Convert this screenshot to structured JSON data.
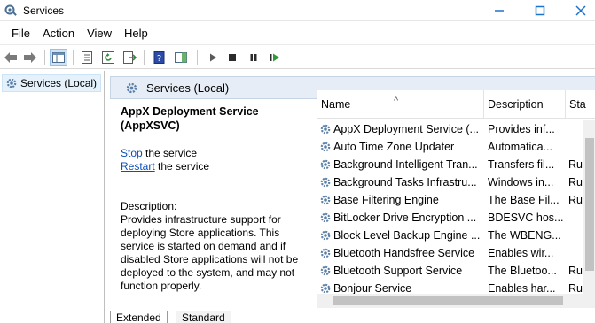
{
  "window": {
    "title": "Services"
  },
  "menu": {
    "items": [
      "File",
      "Action",
      "View",
      "Help"
    ]
  },
  "toolbar": {
    "icons": [
      "back-icon",
      "forward-icon",
      "console-tree-icon",
      "properties-icon",
      "refresh-icon",
      "export-list-icon",
      "help-icon",
      "show-hide-action-pane-icon",
      "start-service-icon",
      "stop-service-icon",
      "pause-service-icon",
      "restart-service-icon"
    ]
  },
  "tree": {
    "selected_label": "Services (Local)"
  },
  "pane": {
    "header": "Services (Local)"
  },
  "details": {
    "service_title": "AppX Deployment Service (AppXSVC)",
    "stop_link": "Stop",
    "stop_suffix": " the service",
    "restart_link": "Restart",
    "restart_suffix": " the service",
    "description_label": "Description:",
    "description_text": "Provides infrastructure support for deploying Store applications. This service is started on demand and if disabled Store applications will not be deployed to the system, and may not function properly."
  },
  "list": {
    "columns": {
      "name": "Name",
      "description": "Description",
      "status": "Sta"
    },
    "rows": [
      {
        "name": "AppX Deployment Service (...",
        "description": "Provides inf...",
        "status": ""
      },
      {
        "name": "Auto Time Zone Updater",
        "description": "Automatica...",
        "status": ""
      },
      {
        "name": "Background Intelligent Tran...",
        "description": "Transfers fil...",
        "status": "Run"
      },
      {
        "name": "Background Tasks Infrastru...",
        "description": "Windows in...",
        "status": "Run"
      },
      {
        "name": "Base Filtering Engine",
        "description": "The Base Fil...",
        "status": "Run"
      },
      {
        "name": "BitLocker Drive Encryption ...",
        "description": "BDESVC hos...",
        "status": ""
      },
      {
        "name": "Block Level Backup Engine ...",
        "description": "The WBENG...",
        "status": ""
      },
      {
        "name": "Bluetooth Handsfree Service",
        "description": "Enables wir...",
        "status": ""
      },
      {
        "name": "Bluetooth Support Service",
        "description": "The Bluetoo...",
        "status": "Run"
      },
      {
        "name": "Bonjour Service",
        "description": "Enables har...",
        "status": "Run"
      }
    ]
  },
  "tabs": {
    "extended": "Extended",
    "standard": "Standard"
  },
  "colors": {
    "accent": "#1a73c9",
    "link": "#0a4fb5",
    "header_bg": "#e6edf6",
    "tree_selected_bg": "#e5f1fb"
  }
}
